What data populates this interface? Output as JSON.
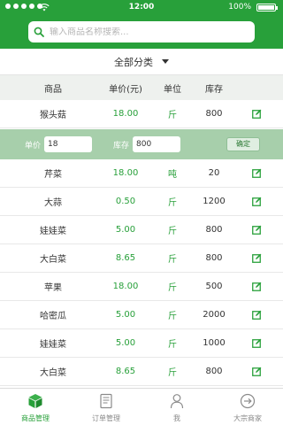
{
  "status_bar": {
    "time": "12:00",
    "battery": "100%"
  },
  "search": {
    "placeholder": "输入商品名称搜索..."
  },
  "category": {
    "label": "全部分类"
  },
  "table": {
    "headers": [
      "商品",
      "单价(元)",
      "单位",
      "库存"
    ],
    "rows": [
      {
        "name": "猴头菇",
        "price": "18.00",
        "unit": "斤",
        "stock": "800"
      },
      {
        "name": "芹菜",
        "price": "18.00",
        "unit": "吨",
        "stock": "20"
      },
      {
        "name": "大蒜",
        "price": "0.50",
        "unit": "斤",
        "stock": "1200"
      },
      {
        "name": "娃娃菜",
        "price": "5.00",
        "unit": "斤",
        "stock": "800"
      },
      {
        "name": "大白菜",
        "price": "8.65",
        "unit": "斤",
        "stock": "800"
      },
      {
        "name": "苹果",
        "price": "18.00",
        "unit": "斤",
        "stock": "500"
      },
      {
        "name": "哈密瓜",
        "price": "5.00",
        "unit": "斤",
        "stock": "2000"
      },
      {
        "name": "娃娃菜",
        "price": "5.00",
        "unit": "斤",
        "stock": "1000"
      },
      {
        "name": "大白菜",
        "price": "8.65",
        "unit": "斤",
        "stock": "800"
      }
    ]
  },
  "edit_row": {
    "price_label": "单价",
    "price_value": "18",
    "stock_label": "库存",
    "stock_value": "800",
    "confirm_label": "确定"
  },
  "tabbar": {
    "tabs": [
      {
        "label": "商品管理",
        "icon": "box-icon",
        "active": true
      },
      {
        "label": "订单管理",
        "icon": "document-icon",
        "active": false
      },
      {
        "label": "我",
        "icon": "person-icon",
        "active": false
      },
      {
        "label": "大宗商家",
        "icon": "arrow-circle-icon",
        "active": false
      }
    ]
  },
  "colors": {
    "brand": "#28a03a",
    "edit_row_bg": "#a7cfab",
    "header_bg": "#eef1ee"
  }
}
